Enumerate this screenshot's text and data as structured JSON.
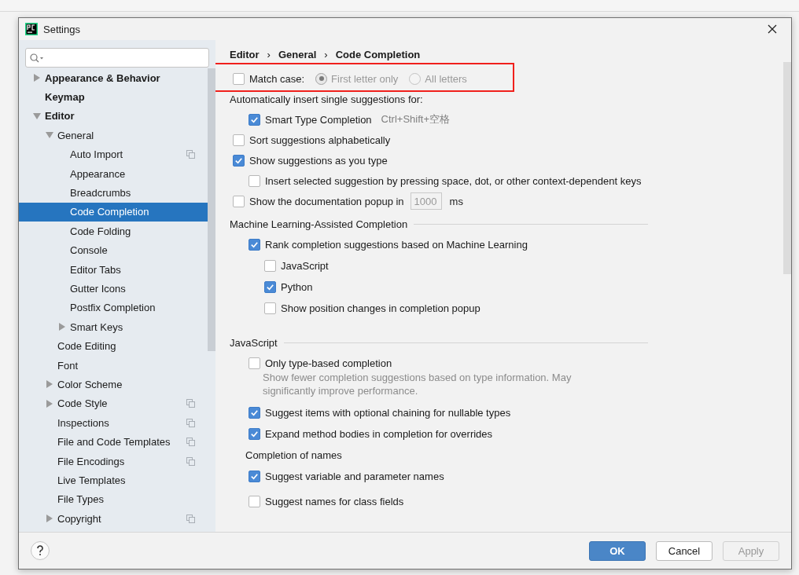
{
  "window": {
    "title": "Settings"
  },
  "sidebar": {
    "items": [
      {
        "label": "Appearance & Behavior",
        "expanded": false
      },
      {
        "label": "Keymap"
      },
      {
        "label": "Editor",
        "expanded": true,
        "children": [
          {
            "label": "General",
            "expanded": true,
            "children": [
              {
                "label": "Auto Import",
                "project_scope": true,
                "selected": false
              },
              {
                "label": "Appearance",
                "selected": false
              },
              {
                "label": "Breadcrumbs",
                "selected": false
              },
              {
                "label": "Code Completion",
                "selected": true
              },
              {
                "label": "Code Folding",
                "selected": false
              },
              {
                "label": "Console",
                "selected": false
              },
              {
                "label": "Editor Tabs",
                "selected": false
              },
              {
                "label": "Gutter Icons",
                "selected": false
              },
              {
                "label": "Postfix Completion",
                "selected": false
              },
              {
                "label": "Smart Keys",
                "expanded": false,
                "selected": false
              }
            ]
          },
          {
            "label": "Code Editing",
            "selected": false
          },
          {
            "label": "Font",
            "selected": false
          },
          {
            "label": "Color Scheme",
            "expanded": false,
            "selected": false
          },
          {
            "label": "Code Style",
            "expanded": false,
            "project_scope": true,
            "selected": false
          },
          {
            "label": "Inspections",
            "project_scope": true,
            "selected": false
          },
          {
            "label": "File and Code Templates",
            "project_scope": true,
            "selected": false
          },
          {
            "label": "File Encodings",
            "project_scope": true,
            "selected": false
          },
          {
            "label": "Live Templates",
            "selected": false
          },
          {
            "label": "File Types",
            "selected": false
          },
          {
            "label": "Copyright",
            "expanded": false,
            "project_scope": true,
            "selected": false
          }
        ]
      }
    ]
  },
  "content": {
    "breadcrumb": [
      "Editor",
      "›",
      "General",
      "›",
      "Code Completion"
    ],
    "rows": [
      {
        "kind": "match_case",
        "label": "Match case:",
        "checked": false,
        "highlighted": true,
        "options": [
          {
            "label": "First letter only",
            "selected": true,
            "disabled": true
          },
          {
            "label": "All letters",
            "selected": false,
            "disabled": true
          }
        ]
      },
      {
        "kind": "label",
        "text": "Automatically insert single suggestions for:",
        "children": [
          {
            "kind": "checkbox",
            "label": "Smart Type Completion",
            "shortcut": "Ctrl+Shift+空格",
            "checked": true
          }
        ]
      },
      {
        "kind": "checkbox",
        "label": "Sort suggestions alphabetically",
        "checked": false
      },
      {
        "kind": "checkbox",
        "label": "Show suggestions as you type",
        "checked": true,
        "children": [
          {
            "kind": "checkbox",
            "label": "Insert selected suggestion by pressing space, dot, or other context-dependent keys",
            "checked": false
          }
        ]
      },
      {
        "kind": "checkbox",
        "label": "Show the documentation popup in",
        "checked": false,
        "field": {
          "value": "1000",
          "disabled": true
        },
        "unit": "ms"
      },
      {
        "kind": "section",
        "title": "Machine Learning-Assisted Completion",
        "children": [
          {
            "kind": "checkbox",
            "label": "Rank completion suggestions based on Machine Learning",
            "checked": true,
            "children": [
              {
                "kind": "checkbox",
                "label": "JavaScript",
                "checked": false
              },
              {
                "kind": "checkbox",
                "label": "Python",
                "checked": true
              },
              {
                "kind": "checkbox",
                "label": "Show position changes in completion popup",
                "checked": false
              }
            ]
          }
        ]
      },
      {
        "kind": "section",
        "title": "JavaScript",
        "children": [
          {
            "kind": "checkbox",
            "label": "Only type-based completion",
            "checked": false,
            "description": "Show fewer completion suggestions based on type information. May significantly improve performance."
          },
          {
            "kind": "checkbox",
            "label": "Suggest items with optional chaining for nullable types",
            "checked": true
          },
          {
            "kind": "checkbox",
            "label": "Expand method bodies in completion for overrides",
            "checked": true
          },
          {
            "kind": "label",
            "text": "Completion of names"
          },
          {
            "kind": "checkbox",
            "label": "Suggest variable and parameter names",
            "checked": true
          },
          {
            "kind": "checkbox",
            "label": "Suggest names for class fields",
            "checked": false
          }
        ]
      }
    ]
  },
  "buttons": [
    {
      "label": "OK",
      "kind": "primary",
      "disabled": false
    },
    {
      "label": "Cancel",
      "kind": "normal",
      "disabled": false
    },
    {
      "label": "Apply",
      "kind": "normal",
      "disabled": true
    }
  ]
}
